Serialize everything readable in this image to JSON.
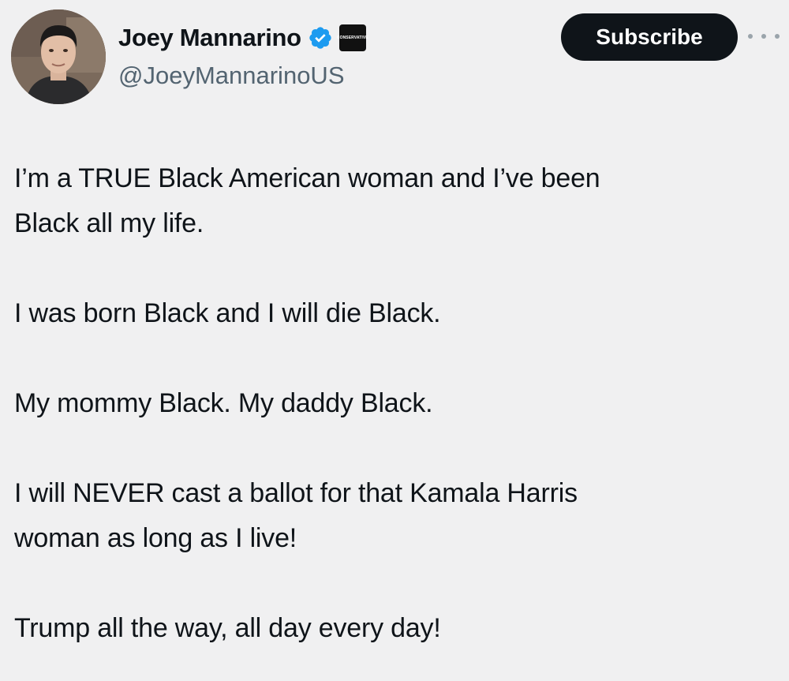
{
  "author": {
    "display_name": "Joey Mannarino",
    "handle": "@JoeyMannarinoUS",
    "avatar": "avatar-photo",
    "verified_icon": "verified-checkmark-icon",
    "affiliate_badge": "CONSERVATIVE"
  },
  "actions": {
    "subscribe_label": "Subscribe",
    "more_icon": "more-dots-icon"
  },
  "tweet": {
    "paragraphs": [
      "I’m a TRUE Black American woman and I’ve been\nBlack all my life.",
      "I was born Black and I will die Black.",
      "My mommy Black. My daddy Black.",
      "I will NEVER cast a ballot for that Kamala Harris\nwoman as long as I live!",
      "Trump all the way, all day every day!"
    ]
  },
  "colors": {
    "background": "#f0f0f1",
    "text": "#0f1419",
    "secondary_text": "#536471",
    "verified_blue": "#1d9bf0",
    "button_bg": "#0f1419"
  }
}
